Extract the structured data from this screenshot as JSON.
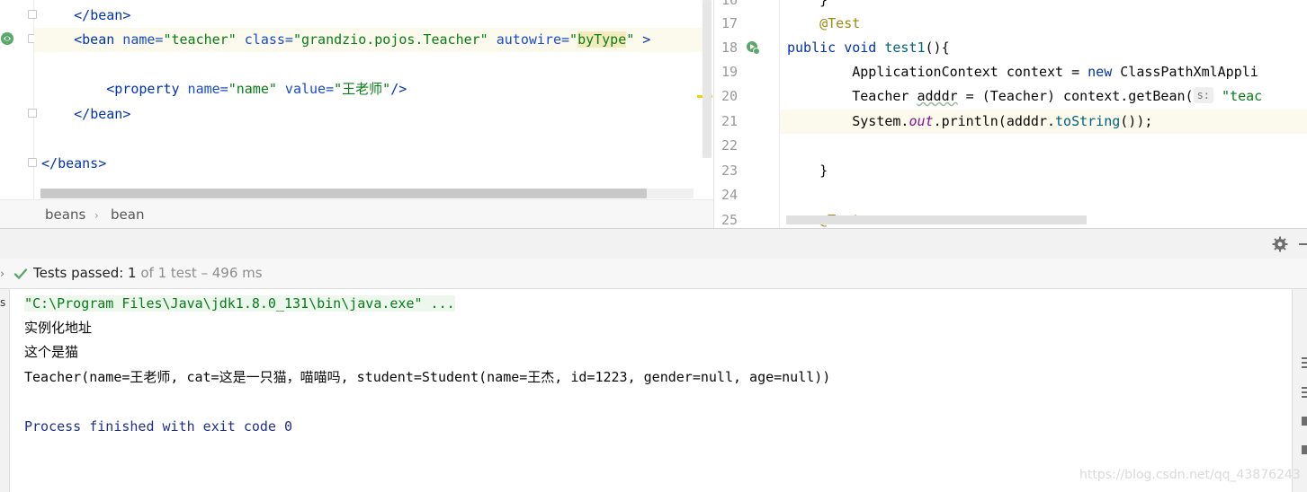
{
  "xml_editor": {
    "lines": [
      {
        "indent": "    ",
        "tag_open": "</",
        "tag_name": "bean",
        "tag_close": ">"
      },
      {
        "indent": "    ",
        "bean_open": "<bean",
        "attr_name1": " name=",
        "attr_val1": "\"teacher\"",
        "attr_name2": " class=",
        "attr_val2": "\"grandzio.pojos.Teacher\"",
        "attr_name3": " autowire=",
        "attr_val3a": "\"",
        "attr_val3b": "byType",
        "attr_val3c": "\"",
        "tail": " >"
      },
      {
        "indent": "        ",
        "prop_open": "<property",
        "p_name": " name=",
        "p_name_val": "\"name\"",
        "p_value": " value=",
        "p_value_val": "\"王老师\"",
        "p_close": "/>"
      },
      {
        "indent": "    ",
        "tag_open": "</",
        "tag_name": "bean",
        "tag_close": ">"
      },
      {
        "indent": "",
        "tag_open": "</",
        "tag_name": "beans",
        "tag_close": ">"
      }
    ]
  },
  "breadcrumb": {
    "items": [
      "beans",
      "bean"
    ],
    "separator": "›"
  },
  "java_editor": {
    "line_numbers": [
      "16",
      "17",
      "18",
      "19",
      "20",
      "21",
      "22",
      "23",
      "24",
      "25"
    ],
    "line17": {
      "annotation": "@Test"
    },
    "line18": {
      "kw1": "public",
      "kw2": " void ",
      "method": "test1",
      "rest": "(){"
    },
    "line19": {
      "a": "ApplicationContext context = ",
      "kw": "new",
      "b": " ClassPathXmlAppli"
    },
    "line20": {
      "a": "Teacher ",
      "b": "adddr",
      "c": " = (Teacher) context.getBean(",
      "hint": "s:",
      "d": " ",
      "str": "\"teac"
    },
    "line21": {
      "a": "System.",
      "fld": "out",
      "b": ".println(adddr.",
      "mth": "toString",
      "c": "());"
    },
    "line23": {
      "a": "}"
    },
    "line25": {
      "annotation": "@Test"
    }
  },
  "test_status": {
    "label": "Tests passed: ",
    "count": "1",
    "rest": " of 1 test – 496 ms"
  },
  "console": {
    "left_label": "s",
    "status_left_marker": "›",
    "lines": [
      "\"C:\\Program Files\\Java\\jdk1.8.0_131\\bin\\java.exe\" ...",
      "实例化地址",
      "这个是猫",
      "Teacher(name=王老师, cat=这是一只猫，喵喵吗, student=Student(name=王杰, id=1223, gender=null, age=null))",
      "",
      "Process finished with exit code 0"
    ]
  },
  "watermark": "https://blog.csdn.net/qq_43876243",
  "colors": {
    "keyword": "#0033b3",
    "string": "#067d17",
    "annotation": "#9e880d",
    "field": "#871094",
    "method": "#00627a",
    "caret_line": "#fcfaed",
    "pass_green": "#59a869"
  }
}
